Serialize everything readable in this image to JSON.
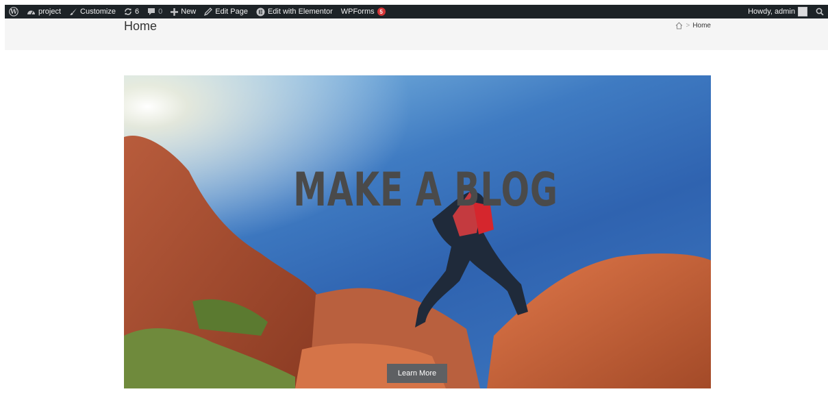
{
  "admin_bar": {
    "site_name": "project",
    "customize_label": "Customize",
    "updates_count": "6",
    "comments_count": "0",
    "new_label": "New",
    "edit_page_label": "Edit Page",
    "elementor_label": "Edit with Elementor",
    "wpforms_label": "WPForms",
    "wpforms_badge": "5",
    "howdy_label": "Howdy, admin"
  },
  "page_header": {
    "title": "Home",
    "breadcrumb": {
      "current": "Home"
    }
  },
  "hero": {
    "heading": "MAKE A BLOG",
    "button_label": "Learn More"
  },
  "icons": {
    "wordpress": "wordpress-logo-icon",
    "site": "gauge-icon",
    "customize": "brush-icon",
    "updates": "refresh-icon",
    "comments": "comment-bubble-icon",
    "new": "plus-icon",
    "edit": "pencil-icon",
    "elementor": "elementor-icon",
    "search": "search-icon",
    "home": "home-icon"
  },
  "colors": {
    "admin_bar_bg": "#1d2327",
    "badge": "#d63638",
    "header_bg": "#f5f5f5",
    "hero_text": "#4a4a4a",
    "button_bg": "#5e6063"
  }
}
